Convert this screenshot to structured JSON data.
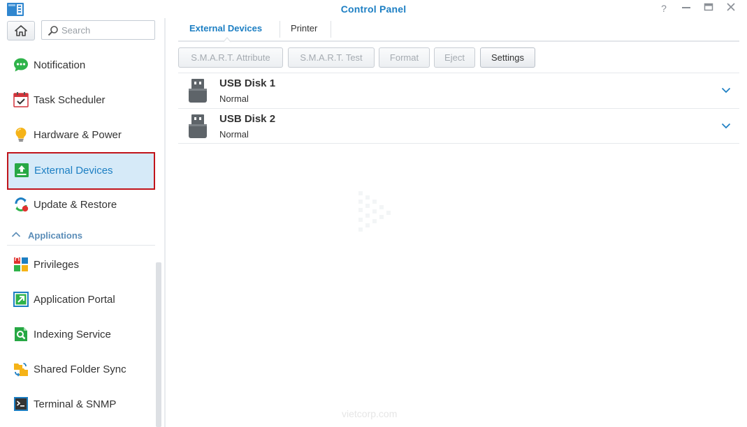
{
  "window": {
    "title": "Control Panel",
    "controls": [
      "help",
      "minimize",
      "maximize",
      "close"
    ]
  },
  "colors": {
    "accent": "#1d7fc3",
    "selected_bg": "#d6eaf8",
    "highlight_border": "#c0141b"
  },
  "sidebar": {
    "search_placeholder": "Search",
    "items": [
      {
        "label": "Notification",
        "icon": "chat-bubble-icon"
      },
      {
        "label": "Task Scheduler",
        "icon": "calendar-check-icon"
      },
      {
        "label": "Hardware & Power",
        "icon": "lightbulb-icon"
      },
      {
        "label": "External Devices",
        "icon": "upload-drive-icon",
        "selected": true
      },
      {
        "label": "Update & Restore",
        "icon": "refresh-icon"
      }
    ],
    "section": {
      "label": "Applications"
    },
    "app_items": [
      {
        "label": "Privileges",
        "icon": "privileges-icon"
      },
      {
        "label": "Application Portal",
        "icon": "portal-arrow-icon"
      },
      {
        "label": "Indexing Service",
        "icon": "indexing-search-icon"
      },
      {
        "label": "Shared Folder Sync",
        "icon": "folder-sync-icon"
      },
      {
        "label": "Terminal & SNMP",
        "icon": "terminal-icon"
      }
    ]
  },
  "main": {
    "tabs": [
      {
        "label": "External Devices",
        "active": true
      },
      {
        "label": "Printer",
        "active": false
      }
    ],
    "toolbar": {
      "smart_attribute": "S.M.A.R.T. Attribute",
      "smart_test": "S.M.A.R.T. Test",
      "format": "Format",
      "eject": "Eject",
      "settings": "Settings"
    },
    "devices": [
      {
        "name": "USB Disk 1",
        "status": "Normal"
      },
      {
        "name": "USB Disk 2",
        "status": "Normal"
      }
    ]
  },
  "watermark": "vietcorp.com"
}
